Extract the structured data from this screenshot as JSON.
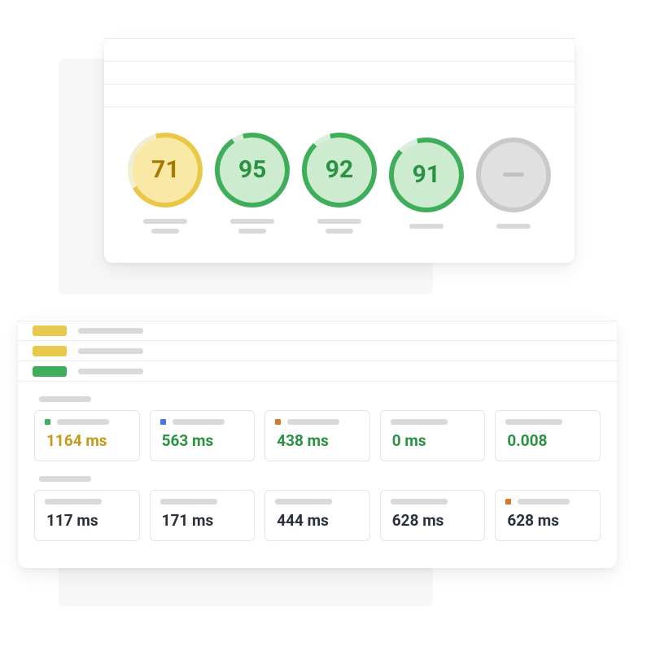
{
  "scores": [
    {
      "value": "71",
      "variant": "yellow",
      "pct": 71,
      "twoLine": true
    },
    {
      "value": "95",
      "variant": "green",
      "pct": 95,
      "twoLine": true
    },
    {
      "value": "92",
      "variant": "green",
      "pct": 92,
      "twoLine": true
    },
    {
      "value": "91",
      "variant": "green",
      "pct": 91,
      "twoLine": false
    },
    {
      "value": "",
      "variant": "grey",
      "pct": 0,
      "twoLine": false
    }
  ],
  "audits": [
    {
      "color": "yellow"
    },
    {
      "color": "yellow"
    },
    {
      "color": "green"
    }
  ],
  "metrics_row1": [
    {
      "dot": "green",
      "value": "1164 ms",
      "color": "yellow"
    },
    {
      "dot": "blue",
      "value": "563 ms",
      "color": "green"
    },
    {
      "dot": "orange",
      "value": "438 ms",
      "color": "green"
    },
    {
      "dot": "none",
      "value": "0 ms",
      "color": "green"
    },
    {
      "dot": "none",
      "value": "0.008",
      "color": "green"
    }
  ],
  "metrics_row2": [
    {
      "dot": "none",
      "value": "117 ms",
      "color": ""
    },
    {
      "dot": "none",
      "value": "171 ms",
      "color": ""
    },
    {
      "dot": "none",
      "value": "444 ms",
      "color": ""
    },
    {
      "dot": "none",
      "value": "628 ms",
      "color": ""
    },
    {
      "dot": "orange",
      "value": "628 ms",
      "color": ""
    }
  ],
  "colors": {
    "ring_yellow": "#eac847",
    "ring_green": "#3fae5a",
    "ring_grey": "#c9c9c9",
    "track_yellow": "#f3edd0",
    "track_green": "#dbeedd",
    "track_grey": "#e8e8e8"
  }
}
